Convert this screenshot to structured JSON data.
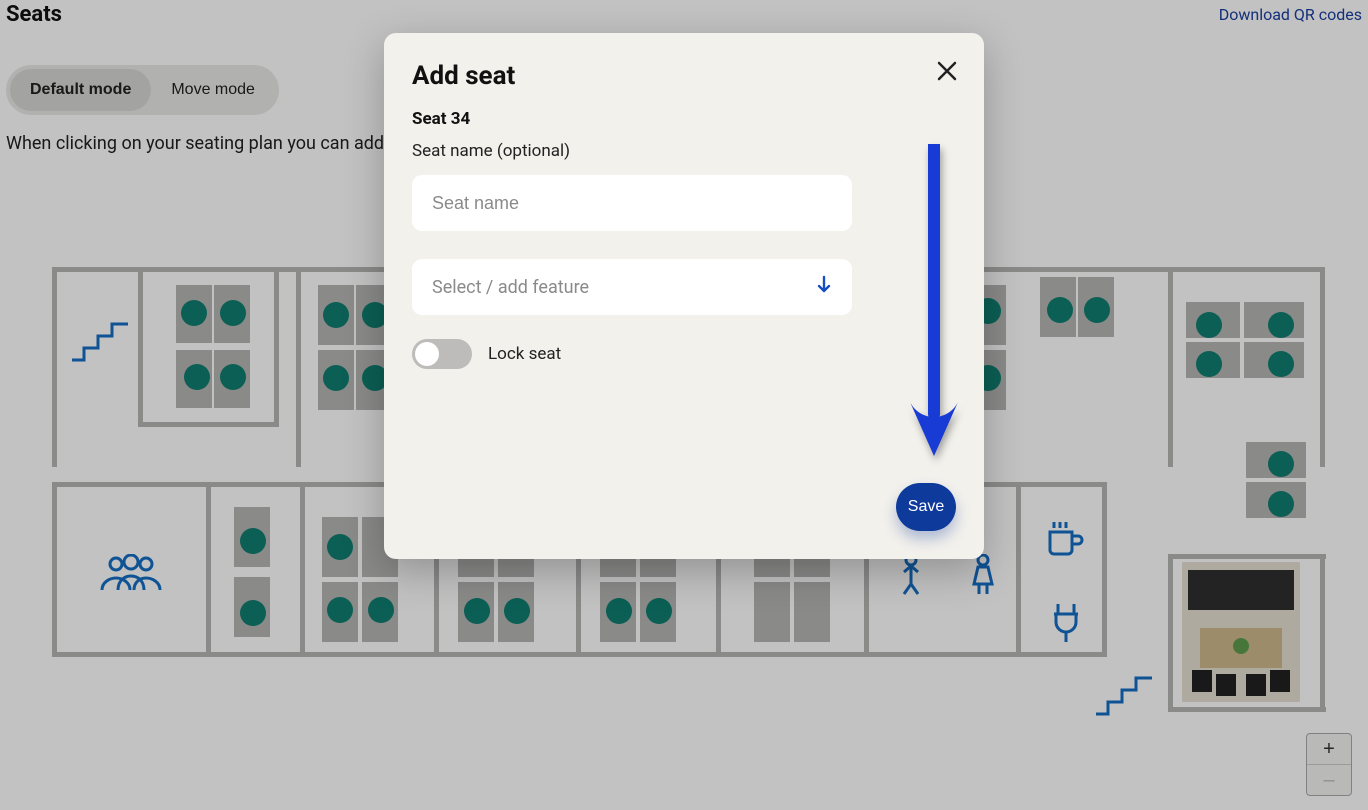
{
  "header": {
    "title": "Seats",
    "qr_link": "Download QR codes"
  },
  "modes": {
    "default": "Default mode",
    "move": "Move mode"
  },
  "hint": "When clicking on your seating plan you can add or edit",
  "zoom": {
    "in": "+",
    "out": "–"
  },
  "modal": {
    "title": "Add seat",
    "seat_heading": "Seat 34",
    "name_label": "Seat name (optional)",
    "name_placeholder": "Seat name",
    "feature_placeholder": "Select / add feature",
    "lock_label": "Lock seat",
    "save": "Save"
  }
}
